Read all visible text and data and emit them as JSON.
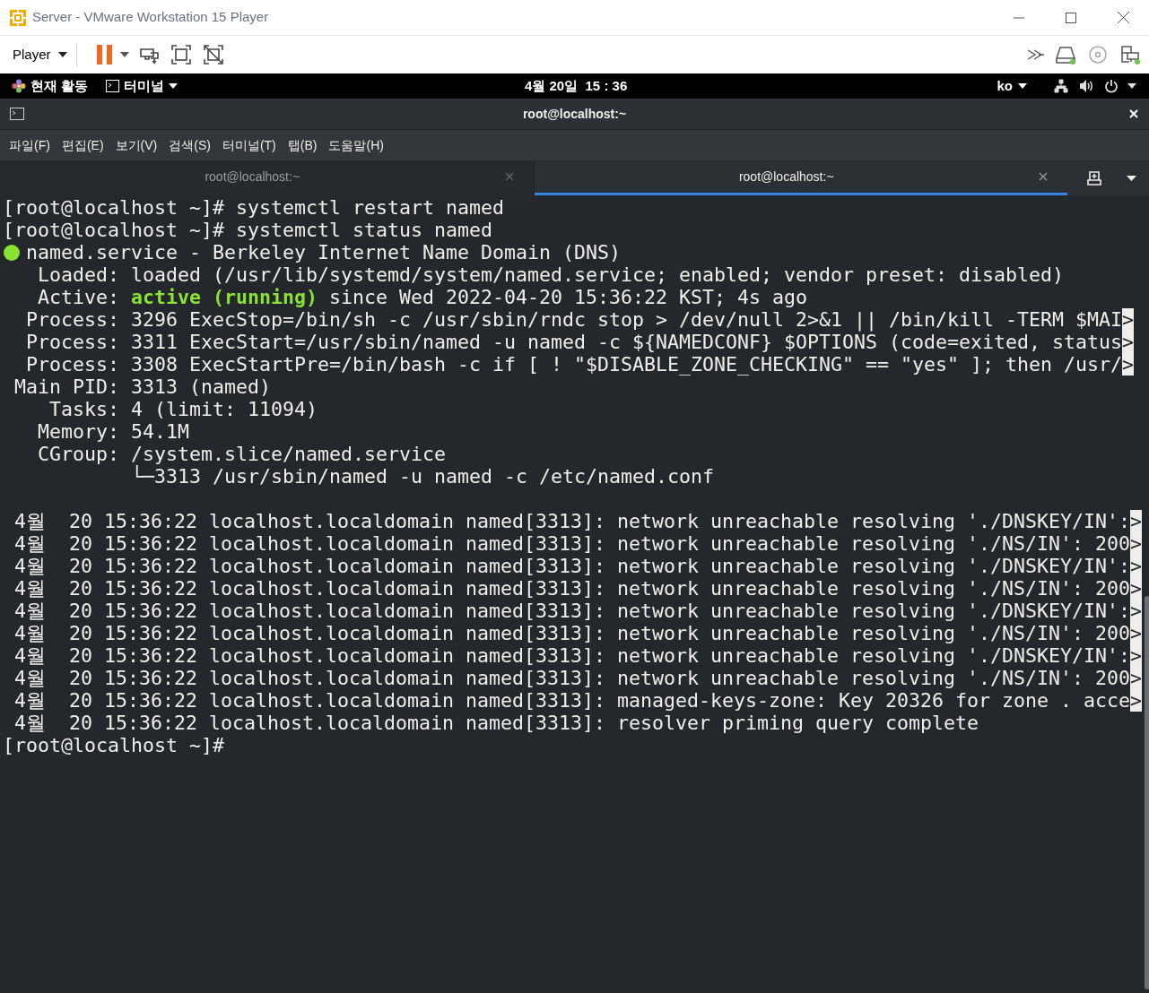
{
  "window": {
    "title": "Server - VMware Workstation 15 Player"
  },
  "player_toolbar": {
    "menu": "Player",
    "paused": true,
    "devices": [
      {
        "kind": "disk",
        "connected": true
      },
      {
        "kind": "cd",
        "connected": false
      },
      {
        "kind": "network",
        "connected": true
      }
    ]
  },
  "top_bar": {
    "activities": "현재 활동",
    "app_menu": "터미널",
    "clock": "4월 20일  15 : 36",
    "input_method": "ko"
  },
  "terminal": {
    "title": "root@localhost:~",
    "menu": [
      "파일(F)",
      "편집(E)",
      "보기(V)",
      "검색(S)",
      "터미널(T)",
      "탭(B)",
      "도움말(H)"
    ],
    "tabs": [
      {
        "label": "root@localhost:~",
        "selected": false
      },
      {
        "label": "root@localhost:~",
        "selected": true
      }
    ],
    "lines": [
      {
        "parts": [
          {
            "text": "[root@localhost ~]# systemctl restart named"
          }
        ]
      },
      {
        "parts": [
          {
            "text": "[root@localhost ~]# systemctl status named"
          }
        ]
      },
      {
        "kind": "unit",
        "color": "#8ae234",
        "parts": [
          {
            "text": "named.service - Berkeley Internet Name Domain (DNS)"
          }
        ]
      },
      {
        "parts": [
          {
            "text": "   Loaded: loaded (/usr/lib/systemd/system/named.service; enabled; vendor preset: disabled)"
          }
        ]
      },
      {
        "parts": [
          {
            "text": "   Active: "
          },
          {
            "text": "active (running)",
            "kind": "ok"
          },
          {
            "text": " since Wed 2022-04-20 15:36:22 KST; 4s ago"
          }
        ]
      },
      {
        "parts": [
          {
            "text": "  Process: 3296 ExecStop=/bin/sh -c /usr/sbin/rndc stop > /dev/null 2>&1 || /bin/kill -TERM $MAI"
          }
        ],
        "more": ">"
      },
      {
        "parts": [
          {
            "text": "  Process: 3311 ExecStart=/usr/sbin/named -u named -c ${NAMEDCONF} $OPTIONS (code=exited, status"
          }
        ],
        "more": ">"
      },
      {
        "parts": [
          {
            "text": "  Process: 3308 ExecStartPre=/bin/bash -c if [ ! \"$DISABLE_ZONE_CHECKING\" == \"yes\" ]; then /usr/"
          }
        ],
        "more": ">"
      },
      {
        "parts": [
          {
            "text": " Main PID: 3313 (named)"
          }
        ]
      },
      {
        "parts": [
          {
            "text": "    Tasks: 4 (limit: 11094)"
          }
        ]
      },
      {
        "parts": [
          {
            "text": "   Memory: 54.1M"
          }
        ]
      },
      {
        "parts": [
          {
            "text": "   CGroup: /system.slice/named.service"
          }
        ]
      },
      {
        "parts": [
          {
            "text": "           └─3313 /usr/sbin/named -u named -c /etc/named.conf"
          }
        ]
      },
      {
        "kind": "blank"
      },
      {
        "parts": [
          {
            "text": " 4월  20 15:36:22 localhost.localdomain named[3313]: network unreachable resolving './DNSKEY/IN':"
          }
        ],
        "more": ">"
      },
      {
        "parts": [
          {
            "text": " 4월  20 15:36:22 localhost.localdomain named[3313]: network unreachable resolving './NS/IN': 200"
          }
        ],
        "more": ">"
      },
      {
        "parts": [
          {
            "text": " 4월  20 15:36:22 localhost.localdomain named[3313]: network unreachable resolving './DNSKEY/IN':"
          }
        ],
        "more": ">"
      },
      {
        "parts": [
          {
            "text": " 4월  20 15:36:22 localhost.localdomain named[3313]: network unreachable resolving './NS/IN': 200"
          }
        ],
        "more": ">"
      },
      {
        "parts": [
          {
            "text": " 4월  20 15:36:22 localhost.localdomain named[3313]: network unreachable resolving './DNSKEY/IN':"
          }
        ],
        "more": ">"
      },
      {
        "parts": [
          {
            "text": " 4월  20 15:36:22 localhost.localdomain named[3313]: network unreachable resolving './NS/IN': 200"
          }
        ],
        "more": ">"
      },
      {
        "parts": [
          {
            "text": " 4월  20 15:36:22 localhost.localdomain named[3313]: network unreachable resolving './DNSKEY/IN':"
          }
        ],
        "more": ">"
      },
      {
        "parts": [
          {
            "text": " 4월  20 15:36:22 localhost.localdomain named[3313]: network unreachable resolving './NS/IN': 200"
          }
        ],
        "more": ">"
      },
      {
        "parts": [
          {
            "text": " 4월  20 15:36:22 localhost.localdomain named[3313]: managed-keys-zone: Key 20326 for zone . acce"
          }
        ],
        "more": ">"
      },
      {
        "parts": [
          {
            "text": " 4월  20 15:36:22 localhost.localdomain named[3313]: resolver priming query complete"
          }
        ]
      },
      {
        "parts": [
          {
            "text": "[root@localhost ~]#"
          }
        ]
      }
    ]
  }
}
